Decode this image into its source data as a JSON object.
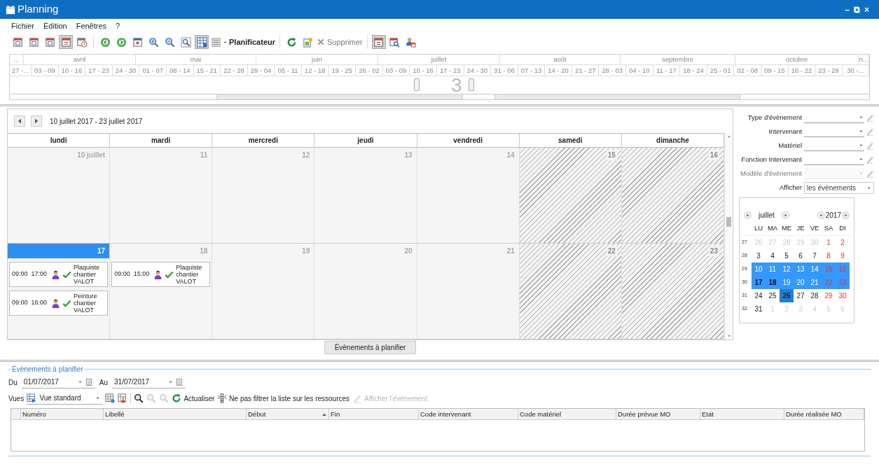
{
  "window": {
    "title": "Planning",
    "controls": [
      "–",
      "⧉",
      "×"
    ]
  },
  "menu": [
    "Fichier",
    "Édition",
    "Fenêtres",
    "?"
  ],
  "toolbar": [
    {
      "kind": "icon",
      "selected": false
    },
    {
      "kind": "icon",
      "selected": false
    },
    {
      "kind": "icon",
      "selected": false
    },
    {
      "kind": "icon",
      "selected": true
    },
    {
      "kind": "icon",
      "selected": false
    },
    {
      "kind": "icon",
      "selected": false
    },
    {
      "kind": "icon",
      "selected": false
    },
    {
      "kind": "icon",
      "selected": false
    },
    {
      "kind": "icon",
      "selected": false
    },
    {
      "kind": "icon",
      "selected": false
    },
    {
      "kind": "icon",
      "selected": false
    },
    {
      "kind": "icon",
      "selected": true
    },
    {
      "kind": "menu",
      "label": "Planificateur"
    },
    {
      "kind": "icon",
      "selected": false
    },
    {
      "kind": "icon",
      "selected": false
    },
    {
      "kind": "button",
      "label": "Supprimer",
      "disabled": true
    },
    {
      "kind": "icon",
      "selected": true
    },
    {
      "kind": "icon",
      "selected": false
    },
    {
      "kind": "icon",
      "selected": false
    }
  ],
  "timeline": {
    "months": [
      "...",
      "avril",
      "mai",
      "juin",
      "juillet",
      "août",
      "septembre",
      "octobre",
      "n..."
    ],
    "weeks": [
      "27 -...",
      "03 - 09",
      "10 - 16",
      "17 - 23",
      "24 - 30",
      "01 - 07",
      "08 - 14",
      "15 - 21",
      "22 - 28",
      "29 - 04",
      "05 - 11",
      "12 - 18",
      "19 - 25",
      "26 - 02",
      "03 - 09",
      "10 - 16",
      "17 - 23",
      "24 - 30",
      "31 - 06",
      "07 - 13",
      "14 - 20",
      "21 - 27",
      "28 - 03",
      "04 - 10",
      "11 - 17",
      "18 - 24",
      "25 - 01",
      "02 - 08",
      "09 - 15",
      "16 - 22",
      "23 - 29",
      "30 -..."
    ],
    "counter": "3"
  },
  "calendar": {
    "range": "10 juillet 2017 - 23 juillet 2017",
    "days": [
      "lundi",
      "mardi",
      "mercredi",
      "jeudi",
      "vendredi",
      "samedi",
      "dimanche"
    ],
    "weeks": [
      {
        "cells": [
          {
            "label": "10 juillet",
            "weekend": false,
            "selected": false
          },
          {
            "label": "11",
            "weekend": false,
            "selected": false
          },
          {
            "label": "12",
            "weekend": false,
            "selected": false
          },
          {
            "label": "13",
            "weekend": false,
            "selected": false
          },
          {
            "label": "14",
            "weekend": false,
            "selected": false
          },
          {
            "label": "15",
            "weekend": true,
            "selected": false
          },
          {
            "label": "16",
            "weekend": true,
            "selected": false
          }
        ]
      },
      {
        "cells": [
          {
            "label": "17",
            "weekend": false,
            "selected": true,
            "events": [
              {
                "start": "09:00",
                "end": "17:00",
                "text": "Plaquiste chantier VALOT"
              },
              {
                "start": "09:00",
                "end": "16:00",
                "text": "Peinture chantier VALOT"
              }
            ]
          },
          {
            "label": "18",
            "weekend": false,
            "selected": false,
            "events": [
              {
                "start": "09:00",
                "end": "15:00",
                "text": "Plaquiste chantier VALOT"
              }
            ]
          },
          {
            "label": "19",
            "weekend": false,
            "selected": false
          },
          {
            "label": "20",
            "weekend": false,
            "selected": false
          },
          {
            "label": "21",
            "weekend": false,
            "selected": false
          },
          {
            "label": "22",
            "weekend": true,
            "selected": false
          },
          {
            "label": "23",
            "weekend": true,
            "selected": false
          }
        ]
      }
    ],
    "button": "Évènements à planifier"
  },
  "filters": [
    {
      "kind": "filter",
      "label": "Type d'évènement",
      "disabled": false
    },
    {
      "kind": "filter",
      "label": "Intervenant",
      "disabled": false
    },
    {
      "kind": "filter",
      "label": "Matériel",
      "disabled": false
    },
    {
      "kind": "filter",
      "label": "Fonction Intervenant",
      "disabled": false
    },
    {
      "kind": "filter",
      "label": "Modèle d'évènement",
      "disabled": true
    },
    {
      "kind": "combo",
      "label": "Afficher",
      "value": "les évènements"
    }
  ],
  "mini_calendar": {
    "month": "juillet",
    "year": "2017",
    "weekdays": [
      "LU",
      "MA",
      "ME",
      "JE",
      "VE",
      "SA",
      "DI"
    ],
    "weeks": [
      {
        "num": "27",
        "days": [
          {
            "d": "26",
            "other": true,
            "selected": false,
            "bold": false,
            "today": false
          },
          {
            "d": "27",
            "other": true,
            "selected": false,
            "bold": false,
            "today": false
          },
          {
            "d": "28",
            "other": true,
            "selected": false,
            "bold": false,
            "today": false
          },
          {
            "d": "29",
            "other": true,
            "selected": false,
            "bold": false,
            "today": false
          },
          {
            "d": "30",
            "other": true,
            "selected": false,
            "bold": false,
            "today": false
          },
          {
            "d": "1",
            "other": false,
            "selected": false,
            "bold": false,
            "today": false
          },
          {
            "d": "2",
            "other": false,
            "selected": false,
            "bold": false,
            "today": false
          }
        ]
      },
      {
        "num": "28",
        "days": [
          {
            "d": "3",
            "other": false,
            "selected": false,
            "bold": false,
            "today": false
          },
          {
            "d": "4",
            "other": false,
            "selected": false,
            "bold": false,
            "today": false
          },
          {
            "d": "5",
            "other": false,
            "selected": false,
            "bold": false,
            "today": false
          },
          {
            "d": "6",
            "other": false,
            "selected": false,
            "bold": false,
            "today": false
          },
          {
            "d": "7",
            "other": false,
            "selected": false,
            "bold": false,
            "today": false
          },
          {
            "d": "8",
            "other": false,
            "selected": false,
            "bold": false,
            "today": false
          },
          {
            "d": "9",
            "other": false,
            "selected": false,
            "bold": false,
            "today": false
          }
        ]
      },
      {
        "num": "29",
        "days": [
          {
            "d": "10",
            "other": false,
            "selected": true,
            "bold": false,
            "today": false
          },
          {
            "d": "11",
            "other": false,
            "selected": true,
            "bold": false,
            "today": false
          },
          {
            "d": "12",
            "other": false,
            "selected": true,
            "bold": false,
            "today": false
          },
          {
            "d": "13",
            "other": false,
            "selected": true,
            "bold": false,
            "today": false
          },
          {
            "d": "14",
            "other": false,
            "selected": true,
            "bold": false,
            "today": false
          },
          {
            "d": "15",
            "other": false,
            "selected": true,
            "bold": false,
            "today": false
          },
          {
            "d": "16",
            "other": false,
            "selected": true,
            "bold": false,
            "today": false
          }
        ]
      },
      {
        "num": "30",
        "days": [
          {
            "d": "17",
            "other": false,
            "selected": true,
            "bold": true,
            "today": false
          },
          {
            "d": "18",
            "other": false,
            "selected": true,
            "bold": true,
            "today": false
          },
          {
            "d": "19",
            "other": false,
            "selected": true,
            "bold": false,
            "today": false
          },
          {
            "d": "20",
            "other": false,
            "selected": true,
            "bold": false,
            "today": false
          },
          {
            "d": "21",
            "other": false,
            "selected": true,
            "bold": false,
            "today": false
          },
          {
            "d": "22",
            "other": false,
            "selected": true,
            "bold": false,
            "today": false
          },
          {
            "d": "23",
            "other": false,
            "selected": true,
            "bold": false,
            "today": false
          }
        ]
      },
      {
        "num": "31",
        "days": [
          {
            "d": "24",
            "other": false,
            "selected": false,
            "bold": false,
            "today": false
          },
          {
            "d": "25",
            "other": false,
            "selected": false,
            "bold": false,
            "today": false
          },
          {
            "d": "26",
            "other": false,
            "selected": true,
            "bold": false,
            "today": true
          },
          {
            "d": "27",
            "other": false,
            "selected": false,
            "bold": false,
            "today": false
          },
          {
            "d": "28",
            "other": false,
            "selected": false,
            "bold": false,
            "today": false
          },
          {
            "d": "29",
            "other": false,
            "selected": false,
            "bold": false,
            "today": false
          },
          {
            "d": "30",
            "other": false,
            "selected": false,
            "bold": false,
            "today": false
          }
        ]
      },
      {
        "num": "32",
        "days": [
          {
            "d": "31",
            "other": false,
            "selected": false,
            "bold": false,
            "today": false
          },
          {
            "d": "1",
            "other": true,
            "selected": false,
            "bold": false,
            "today": false
          },
          {
            "d": "2",
            "other": true,
            "selected": false,
            "bold": false,
            "today": false
          },
          {
            "d": "3",
            "other": true,
            "selected": false,
            "bold": false,
            "today": false
          },
          {
            "d": "4",
            "other": true,
            "selected": false,
            "bold": false,
            "today": false
          },
          {
            "d": "5",
            "other": true,
            "selected": false,
            "bold": false,
            "today": false
          },
          {
            "d": "6",
            "other": true,
            "selected": false,
            "bold": false,
            "today": false
          }
        ]
      }
    ]
  },
  "unplanned": {
    "title": "Évènements à planifier",
    "from": {
      "label": "Du",
      "value": "01/07/2017"
    },
    "to": {
      "label": "Au",
      "value": "31/07/2017"
    },
    "views": {
      "label": "Vues",
      "value": "Vue standard"
    },
    "tools": [
      {
        "kind": "icon",
        "disabled": false
      },
      {
        "kind": "icon",
        "disabled": false
      },
      {
        "kind": "icon",
        "disabled": false
      },
      {
        "kind": "icon",
        "disabled": true
      },
      {
        "kind": "icon",
        "disabled": true
      },
      {
        "kind": "button",
        "label": "Actualiser",
        "disabled": false
      },
      {
        "kind": "button",
        "label": "Ne pas filtrer la liste sur les ressources",
        "disabled": false
      },
      {
        "kind": "button",
        "label": "Afficher l'évènement",
        "disabled": true
      }
    ],
    "columns": [
      {
        "label": "Numéro",
        "sorted": false
      },
      {
        "label": "Libellé",
        "sorted": false
      },
      {
        "label": "Début",
        "sorted": true
      },
      {
        "label": "Fin",
        "sorted": false
      },
      {
        "label": "Code intervenant",
        "sorted": false
      },
      {
        "label": "Code matériel",
        "sorted": false
      },
      {
        "label": "Durée prévue MO",
        "sorted": false
      },
      {
        "label": "Etat",
        "sorted": false
      },
      {
        "label": "Durée réalisée MO",
        "sorted": false
      }
    ]
  }
}
